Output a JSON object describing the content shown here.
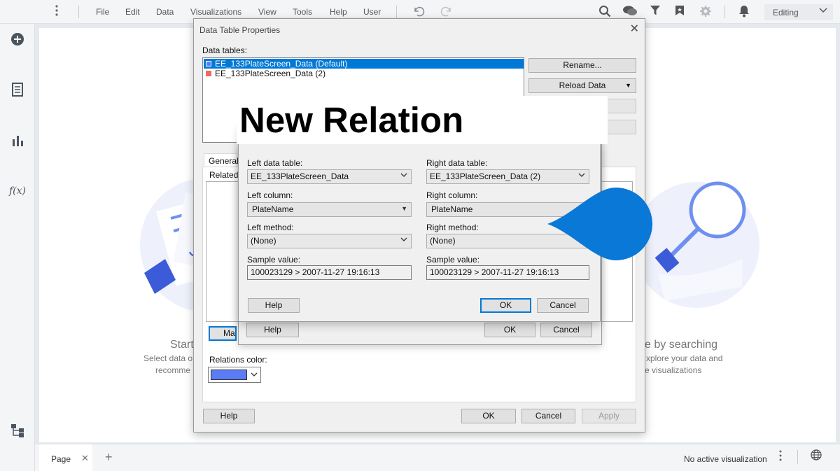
{
  "menu": {
    "items": [
      "File",
      "Edit",
      "Data",
      "Visualizations",
      "View",
      "Tools",
      "Help",
      "User"
    ],
    "mode": "Editing"
  },
  "canvas": {
    "left_title": "Start",
    "left_line1": "Select data o",
    "left_line2": "recomme",
    "right_title": "e by searching",
    "right_line1": "xplore your data and",
    "right_line2": "e visualizations"
  },
  "bottom": {
    "page_tab": "Page",
    "status": "No active visualization"
  },
  "dtp": {
    "title": "Data Table Properties",
    "data_tables_label": "Data tables:",
    "tables": [
      {
        "name": "EE_133PlateScreen_Data (Default)",
        "color": "#5b7cf5",
        "selected": true
      },
      {
        "name": "EE_133PlateScreen_Data (2)",
        "color": "#ee6a5a",
        "selected": false
      }
    ],
    "rename": "Rename...",
    "reload": "Reload Data",
    "tab_general": "General",
    "related_label": "Related c",
    "manage_btn_partial": "Ma",
    "relations_color_label": "Relations color:",
    "relations_color": "#5b7cf5",
    "help": "Help",
    "ok": "OK",
    "cancel": "Cancel",
    "apply": "Apply"
  },
  "manage": {
    "help": "Help",
    "ok": "OK",
    "cancel": "Cancel"
  },
  "new_relation": {
    "title": "New Relation",
    "left_table_label": "Left data table:",
    "left_table_value": "EE_133PlateScreen_Data",
    "right_table_label": "Right data table:",
    "right_table_value": "EE_133PlateScreen_Data (2)",
    "left_column_label": "Left column:",
    "left_column_value": "PlateName",
    "right_column_label": "Right column:",
    "right_column_value": "PlateName",
    "left_method_label": "Left method:",
    "left_method_value": "(None)",
    "right_method_label": "Right method:",
    "right_method_value": "(None)",
    "left_sample_label": "Sample value:",
    "left_sample_value": "100023129 > 2007-11-27 19:16:13",
    "right_sample_label": "Sample value:",
    "right_sample_value": "100023129 > 2007-11-27 19:16:13",
    "help": "Help",
    "ok": "OK",
    "cancel": "Cancel"
  },
  "colors": {
    "accent": "#0078d7",
    "selection": "#0078d7",
    "callout": "#0a78d6"
  }
}
